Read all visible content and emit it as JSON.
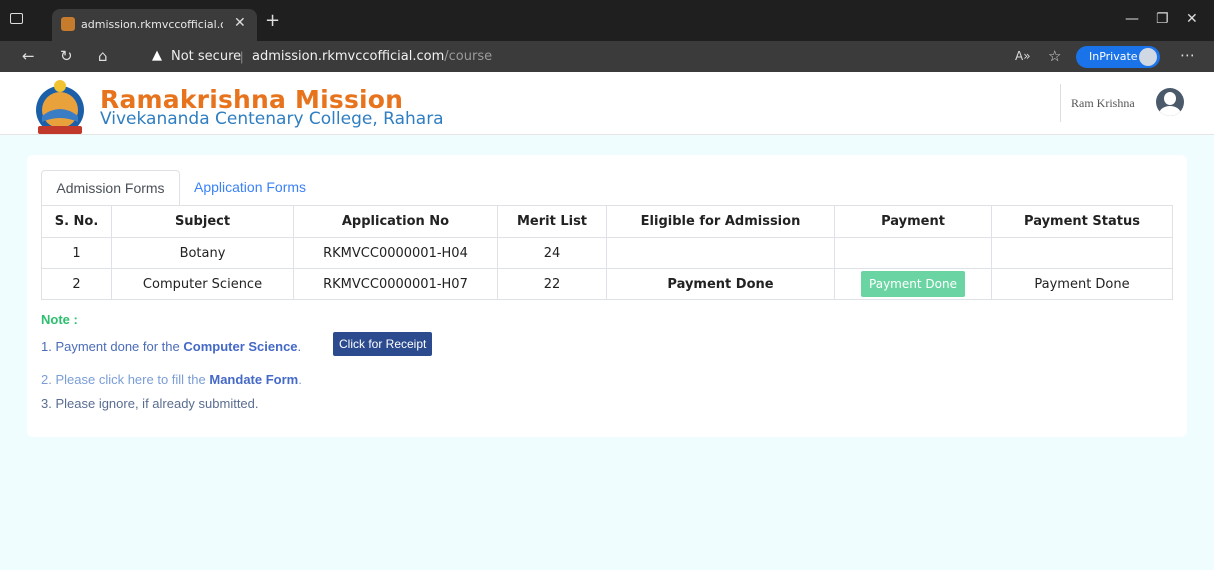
{
  "browser": {
    "tab_title": "admission.rkmvccofficial.com/co",
    "security_label": "Not secure",
    "url_host": "admission.rkmvccofficial.com",
    "url_path": "/course",
    "inprivate_label": "InPrivate"
  },
  "header": {
    "brand_title": "Ramakrishna Mission",
    "brand_subtitle": "Vivekananda Centenary College, Rahara",
    "user_name": "Ram Krishna"
  },
  "tabs": [
    {
      "label": "Admission Forms",
      "active": true
    },
    {
      "label": "Application Forms",
      "active": false
    }
  ],
  "table": {
    "headers": [
      "S. No.",
      "Subject",
      "Application No",
      "Merit List",
      "Eligible for Admission",
      "Payment",
      "Payment Status"
    ],
    "rows": [
      {
        "sno": "1",
        "subject": "Botany",
        "app_no": "RKMVCC0000001-H04",
        "merit": "24",
        "eligible": "",
        "payment": "",
        "status": ""
      },
      {
        "sno": "2",
        "subject": "Computer Science",
        "app_no": "RKMVCC0000001-H07",
        "merit": "22",
        "eligible": "Payment Done",
        "payment": "Payment Done",
        "status": "Payment Done"
      }
    ]
  },
  "note": {
    "title": "Note :",
    "line1_prefix": "1. Payment done for the",
    "line1_subject": "Computer Science",
    "line1_suffix": ".",
    "receipt_button": "Click for Receipt",
    "line2_prefix": "2. Please click here to fill the",
    "line2_link": "Mandate Form",
    "line2_suffix": ".",
    "line3": "3. Please ignore, if already submitted."
  }
}
